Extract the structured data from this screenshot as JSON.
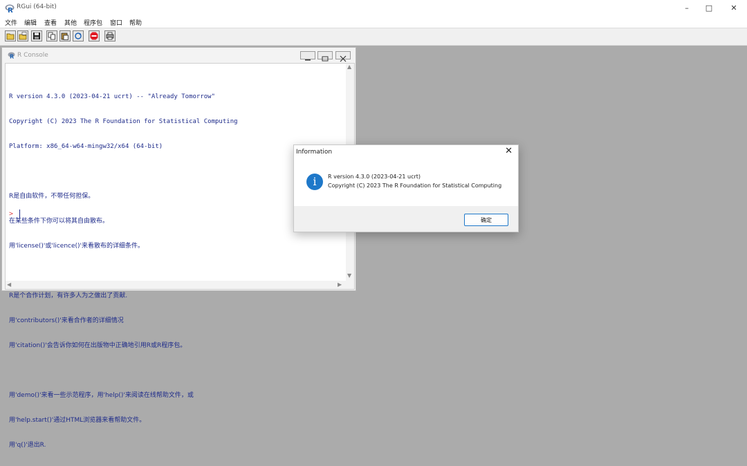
{
  "app": {
    "title": "RGui (64-bit)",
    "window_controls": {
      "minimize": "–",
      "maximize": "□",
      "close": "✕"
    }
  },
  "menu": [
    "文件",
    "编辑",
    "查看",
    "其他",
    "程序包",
    "窗口",
    "帮助"
  ],
  "toolbar": {
    "icons": [
      "open-script-icon",
      "load-workspace-icon",
      "save-icon",
      "copy-icon",
      "paste-icon",
      "copy-paste-icon",
      "stop-icon",
      "print-icon"
    ]
  },
  "console": {
    "title": "R Console",
    "lines": [
      "R version 4.3.0 (2023-04-21 ucrt) -- \"Already Tomorrow\"",
      "Copyright (C) 2023 The R Foundation for Statistical Computing",
      "Platform: x86_64-w64-mingw32/x64 (64-bit)",
      "",
      "R是自由软件，不带任何担保。",
      "在某些条件下你可以将其自由散布。",
      "用'license()'或'licence()'来看散布的详细条件。",
      "",
      "R是个合作计划，有许多人为之做出了贡献.",
      "用'contributors()'来看合作者的详细情况",
      "用'citation()'会告诉你如何在出版物中正确地引用R或R程序包。",
      "",
      "用'demo()'来看一些示范程序，用'help()'来阅读在线帮助文件，或",
      "用'help.start()'通过HTML浏览器来看帮助文件。",
      "用'q()'退出R."
    ],
    "prompt": ">"
  },
  "dialog": {
    "title": "Information",
    "close": "✕",
    "icon": "info-icon",
    "message_line1": "R version 4.3.0 (2023-04-21 ucrt)",
    "message_line2": "Copyright (C) 2023 The R Foundation for Statistical Computing",
    "ok_label": "确定"
  },
  "colors": {
    "workspace": "#ababab",
    "console_text": "#1e2b8a",
    "prompt": "#e0484a",
    "info_blue": "#1e78c9"
  }
}
